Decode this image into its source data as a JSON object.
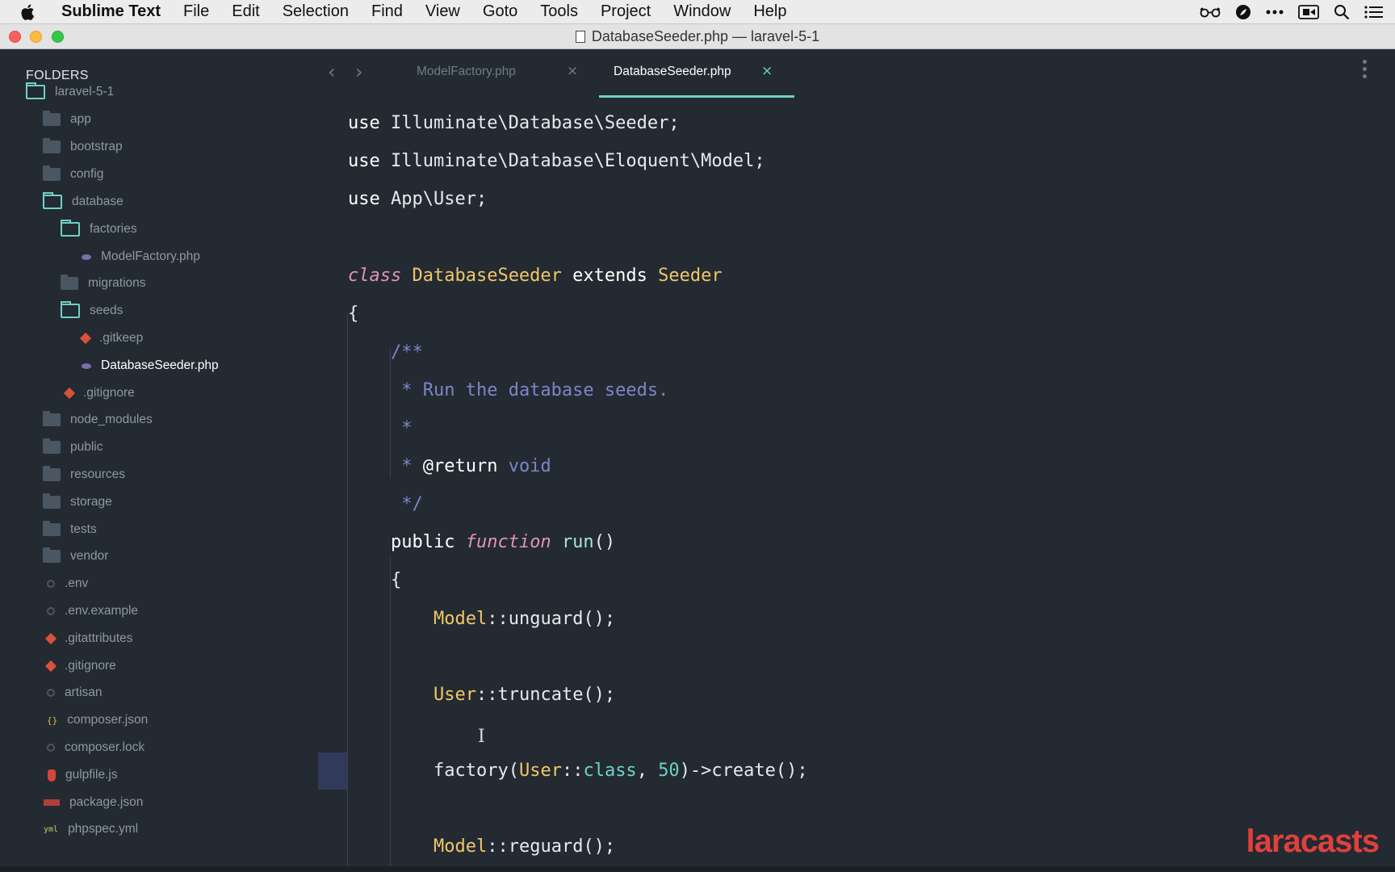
{
  "menubar": {
    "app_name": "Sublime Text",
    "items": [
      "File",
      "Edit",
      "Selection",
      "Find",
      "View",
      "Goto",
      "Tools",
      "Project",
      "Window",
      "Help"
    ]
  },
  "window": {
    "title": "DatabaseSeeder.php — laravel-5-1"
  },
  "sidebar": {
    "heading": "FOLDERS",
    "items": [
      {
        "label": "laravel-5-1",
        "icon": "folder-open-icon"
      },
      {
        "label": "app",
        "icon": "folder-icon"
      },
      {
        "label": "bootstrap",
        "icon": "folder-icon"
      },
      {
        "label": "config",
        "icon": "folder-icon"
      },
      {
        "label": "database",
        "icon": "folder-open-icon"
      },
      {
        "label": "factories",
        "icon": "folder-open-icon"
      },
      {
        "label": "ModelFactory.php",
        "icon": "php-file-icon"
      },
      {
        "label": "migrations",
        "icon": "folder-icon"
      },
      {
        "label": "seeds",
        "icon": "folder-open-icon"
      },
      {
        "label": ".gitkeep",
        "icon": "git-file-icon"
      },
      {
        "label": "DatabaseSeeder.php",
        "icon": "php-file-icon"
      },
      {
        "label": ".gitignore",
        "icon": "git-file-icon"
      },
      {
        "label": "node_modules",
        "icon": "folder-icon"
      },
      {
        "label": "public",
        "icon": "folder-icon"
      },
      {
        "label": "resources",
        "icon": "folder-icon"
      },
      {
        "label": "storage",
        "icon": "folder-icon"
      },
      {
        "label": "tests",
        "icon": "folder-icon"
      },
      {
        "label": "vendor",
        "icon": "folder-icon"
      },
      {
        "label": ".env",
        "icon": "gear-file-icon"
      },
      {
        "label": ".env.example",
        "icon": "gear-file-icon"
      },
      {
        "label": ".gitattributes",
        "icon": "git-file-icon"
      },
      {
        "label": ".gitignore",
        "icon": "git-file-icon"
      },
      {
        "label": "artisan",
        "icon": "gear-file-icon"
      },
      {
        "label": "composer.json",
        "icon": "json-file-icon"
      },
      {
        "label": "composer.lock",
        "icon": "gear-file-icon"
      },
      {
        "label": "gulpfile.js",
        "icon": "gulp-file-icon"
      },
      {
        "label": "package.json",
        "icon": "npm-file-icon"
      },
      {
        "label": "phpspec.yml",
        "icon": "yml-file-icon"
      }
    ]
  },
  "tabs": [
    {
      "label": "ModelFactory.php",
      "active": false
    },
    {
      "label": "DatabaseSeeder.php",
      "active": true
    }
  ],
  "code": {
    "l1": {
      "a": "use ",
      "b": "Illuminate\\Database\\Seeder;"
    },
    "l2": {
      "a": "use ",
      "b": "Illuminate\\Database\\Eloquent\\Model;"
    },
    "l3": {
      "a": "use ",
      "b": "App\\User;"
    },
    "l4": {
      "a": "class",
      "b": " ",
      "c": "DatabaseSeeder",
      "d": " extends ",
      "e": "Seeder"
    },
    "l5": "{",
    "l6": "/**",
    "l7": " * Run the database seeds.",
    "l8": " *",
    "l9": {
      "a": " * ",
      "b": "@return",
      "c": " void"
    },
    "l10": " */",
    "l11": {
      "a": "public ",
      "b": "function",
      "c": " ",
      "d": "run",
      "e": "()"
    },
    "l12": "{",
    "l13": {
      "a": "Model",
      "b": "::unguard();"
    },
    "l14": {
      "a": "User",
      "b": "::truncate();"
    },
    "l15": {
      "a": "factory(",
      "b": "User",
      "c": "::",
      "d": "class",
      "e": ", ",
      "f": "50",
      "g": ")->create();"
    },
    "l16": {
      "a": "Model",
      "b": "::reguard();"
    }
  },
  "watermark": "laracasts",
  "colors": {
    "background": "#232a31",
    "accent": "#6fd1c9",
    "class_name": "#f0c76a",
    "comment": "#7b86c8",
    "keyword_italic": "#e493b6",
    "watermark": "#e0403c"
  }
}
